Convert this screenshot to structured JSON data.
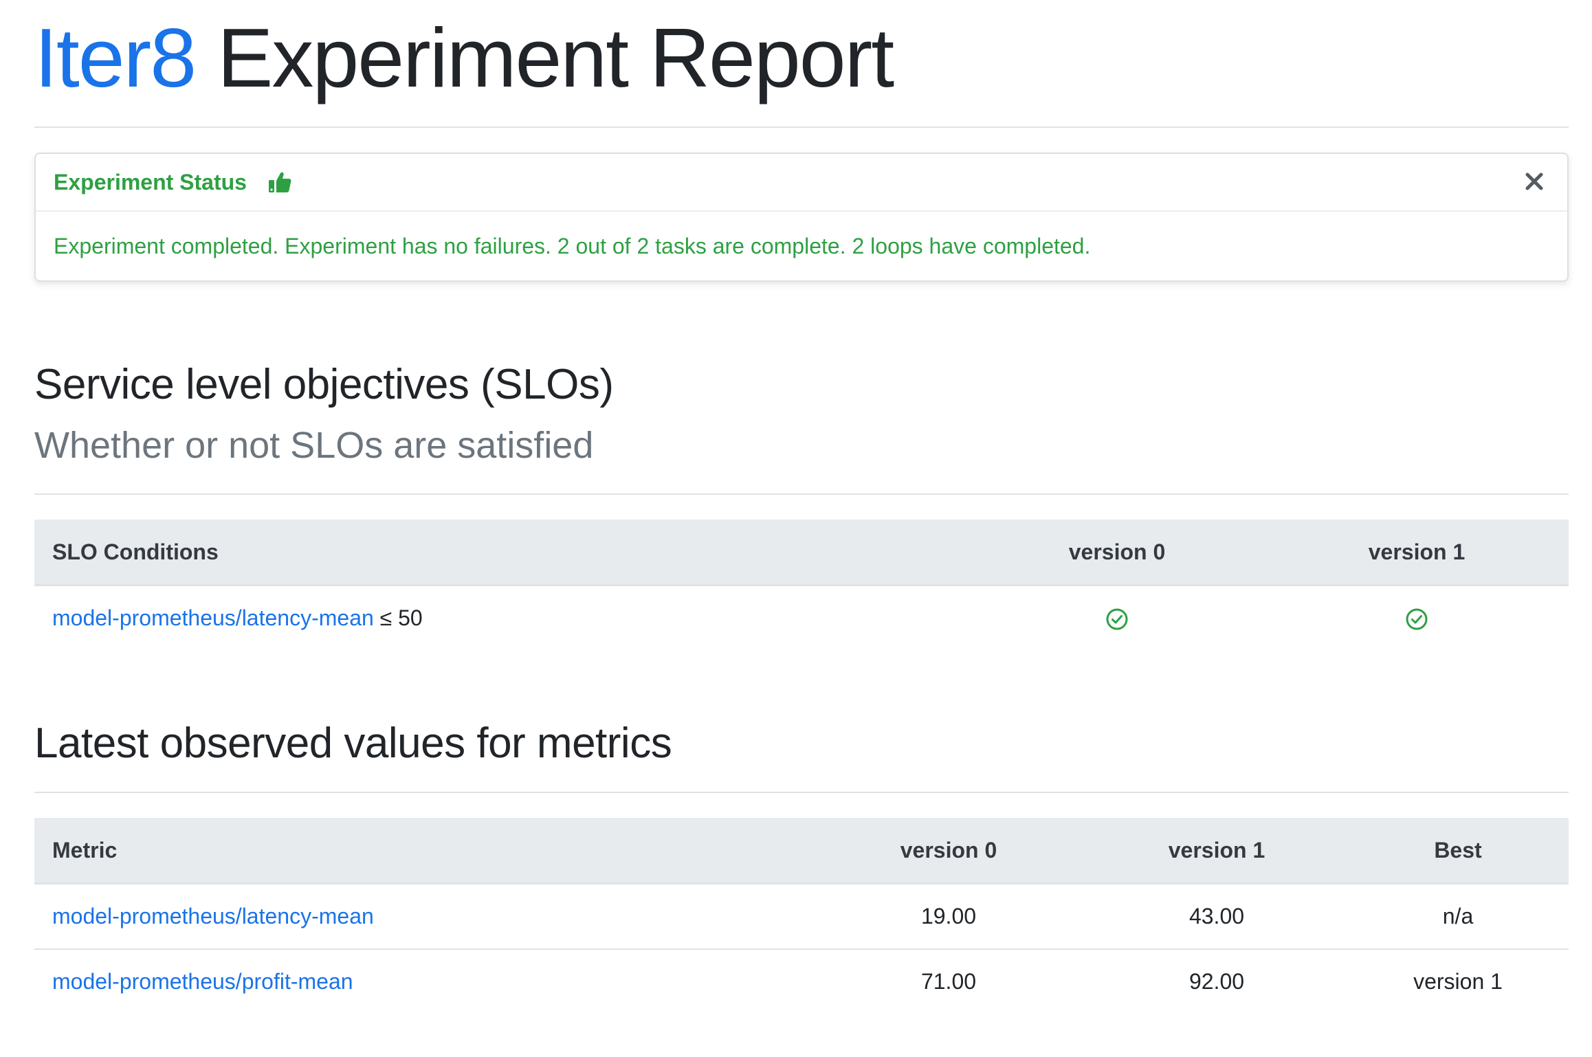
{
  "header": {
    "brand": "Iter8",
    "title_rest": " Experiment Report"
  },
  "status": {
    "title": "Experiment Status",
    "thumb_icon": "thumbs-up-icon",
    "close_icon": "close-icon",
    "message": "Experiment completed. Experiment has no failures. 2 out of 2 tasks are complete. 2 loops have completed.",
    "color": "#2ea043"
  },
  "slo_section": {
    "heading": "Service level objectives (SLOs)",
    "subheading": "Whether or not SLOs are satisfied",
    "table": {
      "columns": [
        "SLO Conditions",
        "version 0",
        "version 1"
      ],
      "rows": [
        {
          "metric": "model-prometheus/latency-mean",
          "condition": "≤ 50",
          "version0_icon": "check-circle-icon",
          "version1_icon": "check-circle-icon",
          "version0_satisfied": true,
          "version1_satisfied": true
        }
      ]
    }
  },
  "metrics_section": {
    "heading": "Latest observed values for metrics",
    "table": {
      "columns": [
        "Metric",
        "version 0",
        "version 1",
        "Best"
      ],
      "rows": [
        {
          "metric": "model-prometheus/latency-mean",
          "v0": "19.00",
          "v1": "43.00",
          "best": "n/a"
        },
        {
          "metric": "model-prometheus/profit-mean",
          "v0": "71.00",
          "v1": "92.00",
          "best": "version 1"
        }
      ]
    }
  },
  "colors": {
    "brand": "#1a73e8",
    "link": "#1a73e8",
    "success": "#2ea043",
    "table_header_bg": "#e8ebee"
  }
}
